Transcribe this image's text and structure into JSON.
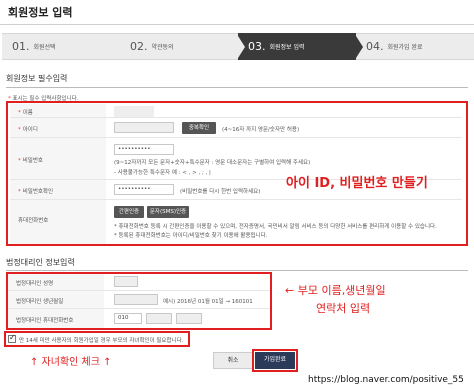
{
  "page": {
    "title": "회원정보 입력"
  },
  "steps": [
    {
      "num": "01.",
      "label": "회원선택",
      "active": false
    },
    {
      "num": "02.",
      "label": "약관동의",
      "active": false
    },
    {
      "num": "03.",
      "label": "회원정보 입력",
      "active": true
    },
    {
      "num": "04.",
      "label": "회원가입 완료",
      "active": false
    }
  ],
  "required_section": {
    "title": "회원정보 필수입력",
    "note_star": "*",
    "note": "표시는 필수 입력사항입니다.",
    "fields": {
      "name": {
        "label": "이름"
      },
      "id": {
        "label": "아이디",
        "button": "중복확인",
        "hint": "(4~16자 까지 영문/숫자만 허용)"
      },
      "password": {
        "label": "비밀번호",
        "value": "••••••••••",
        "hint1": "(9~12자까지 모든 문자+숫자+특수문자 : 영문 대소문자는 구별하여 입력해 주세요)",
        "hint2": "- 사용불가능한 특수문자 예 : < , > , ; , |"
      },
      "password_confirm": {
        "label": "비밀번호확인",
        "value": "••••••••••",
        "hint": "(비밀번호를 다시 한번 입력하세요)"
      },
      "phone_auth": {
        "label": "휴대전화번호",
        "btn_simple": "간편인증",
        "btn_sms": "문자(SMS)인증",
        "desc1": "* 휴대전화번호 등록 시 간편인증을 이용할 수 있으며, 전자증명서, 국민비서 알림 서비스 등의 다양한 서비스를 편리하게 이용할 수 있습니다.",
        "desc2": "* 등록된 휴대전화번호는 아이디/비밀번호 찾기 이용에 활용됩니다."
      }
    }
  },
  "guardian_section": {
    "title": "법정대리인 정보입력",
    "fields": {
      "name": {
        "label": "법정대리인 성명"
      },
      "birth": {
        "label": "법정대리인 생년월일",
        "hint": "예시) 2016년 01월 01일 → 160101"
      },
      "phone": {
        "label": "법정대리인 휴대전화번호",
        "prefix": "010"
      }
    }
  },
  "consent": {
    "text": "만 14세 미만 사용자의 회원가입일 경우 부모의 자녀확인이 필요합니다."
  },
  "buttons": {
    "cancel": "취소",
    "submit": "가입완료"
  },
  "annotations": {
    "id_password": "아이 ID, 비밀번호 만들기",
    "parent_info_line1": "← 부모 이름,생년월일",
    "parent_info_line2": "연락처 입력",
    "child_confirm": "↑ 자녀확인 체크 ↑"
  },
  "watermark": "https://blog.naver.com/positive_55",
  "colors": {
    "annotation_red": "#e02020",
    "active_step": "#3a3a3a",
    "submit_bg": "#2c3a5a"
  }
}
